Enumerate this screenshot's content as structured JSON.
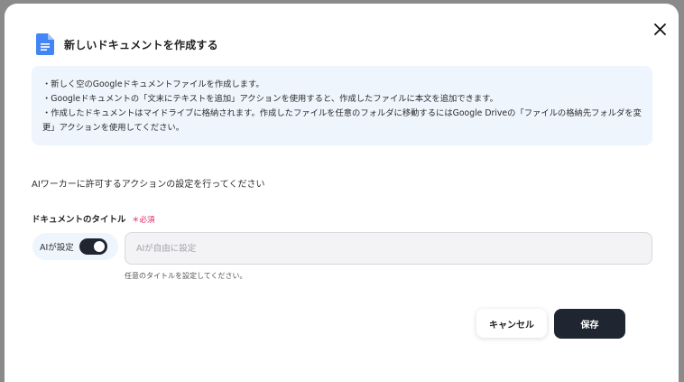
{
  "dialog": {
    "title": "新しいドキュメントを作成する",
    "close_icon": "close-icon",
    "doc_icon": "google-docs-icon",
    "doc_icon_color": "#4285f4"
  },
  "info": {
    "lines": [
      "・新しく空のGoogleドキュメントファイルを作成します。",
      "・Googleドキュメントの「文末にテキストを追加」アクションを使用すると、作成したファイルに本文を追加できます。",
      "・作成したドキュメントはマイドライブに格納されます。作成したファイルを任意のフォルダに移動するにはGoogle Driveの「ファイルの格納先フォルダを変更」アクションを使用してください。"
    ],
    "background": "#eef5fd"
  },
  "settings": {
    "section_label": "AIワーカーに許可するアクションの設定を行ってください"
  },
  "document_title_field": {
    "label": "ドキュメントのタイトル",
    "required_label": "＊必須",
    "required_color": "#e0245e",
    "ai_toggle_label": "AIが設定",
    "ai_toggle_on": true,
    "input_value": "",
    "input_placeholder": "AIが自由に設定",
    "hint": "任意のタイトルを設定してください。"
  },
  "footer": {
    "cancel_label": "キャンセル",
    "save_label": "保存",
    "save_color": "#1f2632"
  }
}
